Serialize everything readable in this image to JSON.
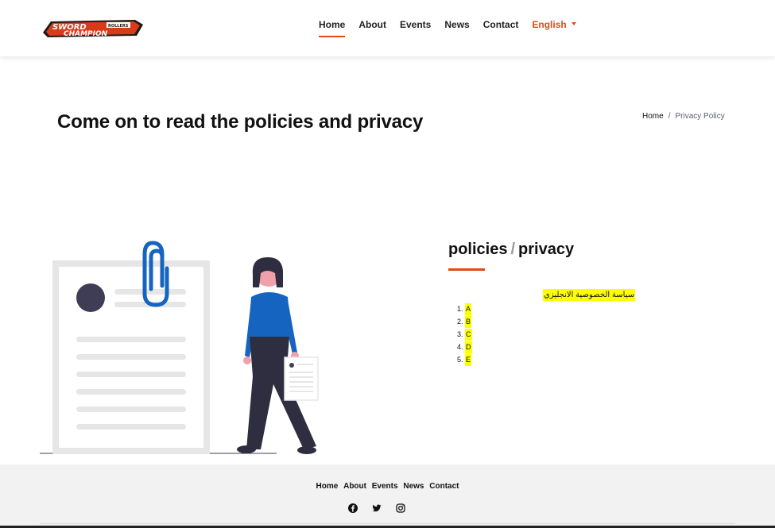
{
  "brand": {
    "logo_top": "SWORD",
    "logo_bottom": "CHAMPION",
    "logo_badge": "ROLLERS"
  },
  "nav": {
    "items": [
      {
        "label": "Home"
      },
      {
        "label": "About"
      },
      {
        "label": "Events"
      },
      {
        "label": "News"
      },
      {
        "label": "Contact"
      }
    ],
    "language": "English"
  },
  "hero": {
    "title": "Come on to read the policies and privacy"
  },
  "breadcrumb": {
    "home": "Home",
    "separator": "/",
    "current": "Privacy Policy"
  },
  "content": {
    "heading_left": "policies",
    "heading_separator": "/",
    "heading_right": "privacy",
    "arabic_title": "سياسة الخصوصية الانجليزي",
    "list": [
      "A",
      "B",
      "C",
      "D",
      "E"
    ]
  },
  "footer": {
    "nav": [
      "Home",
      "About",
      "Events",
      "News",
      "Contact"
    ],
    "socials": [
      "facebook-icon",
      "twitter-icon",
      "instagram-icon"
    ]
  },
  "colors": {
    "accent": "#e04a1a",
    "highlight": "#ffff00",
    "illustration_blue": "#1565c0",
    "footer_bg": "#f2f2f2"
  }
}
